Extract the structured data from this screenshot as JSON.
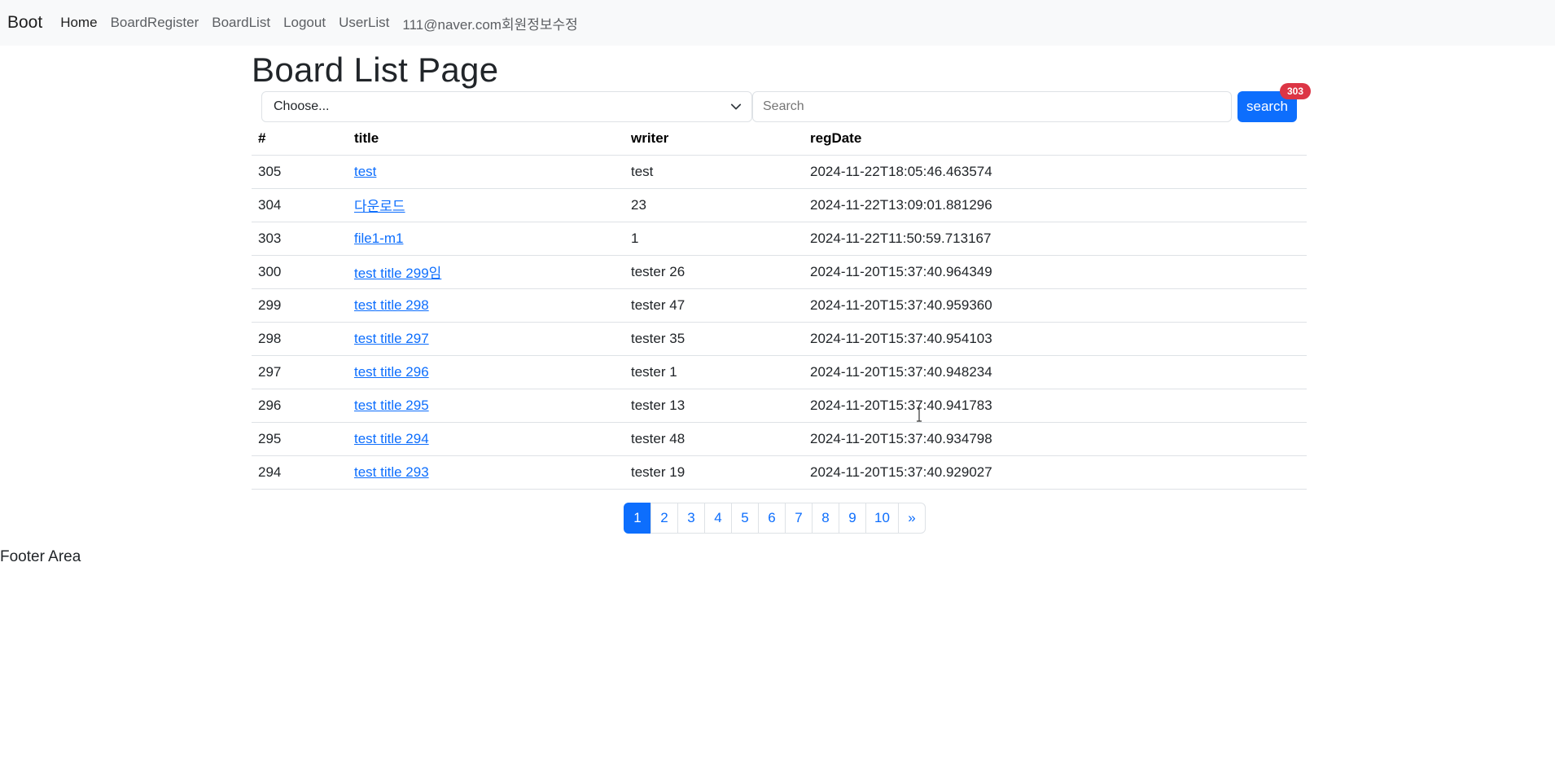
{
  "navbar": {
    "brand": "Boot",
    "items": [
      {
        "label": "Home",
        "active": true
      },
      {
        "label": "BoardRegister",
        "active": false
      },
      {
        "label": "BoardList",
        "active": false
      },
      {
        "label": "Logout",
        "active": false
      },
      {
        "label": "UserList",
        "active": false
      },
      {
        "label": "111@naver.com회원정보수정",
        "active": false
      }
    ]
  },
  "page_title": "Board List Page",
  "search": {
    "select_value": "Choose...",
    "placeholder": "Search",
    "button_label": "search",
    "badge_count": "303"
  },
  "table": {
    "headers": [
      "#",
      "title",
      "writer",
      "regDate"
    ],
    "rows": [
      {
        "id": "305",
        "title": "test",
        "writer": "test",
        "regDate": "2024-11-22T18:05:46.463574"
      },
      {
        "id": "304",
        "title": "다운로드",
        "writer": "23",
        "regDate": "2024-11-22T13:09:01.881296"
      },
      {
        "id": "303",
        "title": "file1-m1",
        "writer": "1",
        "regDate": "2024-11-22T11:50:59.713167"
      },
      {
        "id": "300",
        "title": "test title 299임",
        "writer": "tester 26",
        "regDate": "2024-11-20T15:37:40.964349"
      },
      {
        "id": "299",
        "title": "test title 298",
        "writer": "tester 47",
        "regDate": "2024-11-20T15:37:40.959360"
      },
      {
        "id": "298",
        "title": "test title 297",
        "writer": "tester 35",
        "regDate": "2024-11-20T15:37:40.954103"
      },
      {
        "id": "297",
        "title": "test title 296",
        "writer": "tester 1",
        "regDate": "2024-11-20T15:37:40.948234"
      },
      {
        "id": "296",
        "title": "test title 295",
        "writer": "tester 13",
        "regDate": "2024-11-20T15:37:40.941783"
      },
      {
        "id": "295",
        "title": "test title 294",
        "writer": "tester 48",
        "regDate": "2024-11-20T15:37:40.934798"
      },
      {
        "id": "294",
        "title": "test title 293",
        "writer": "tester 19",
        "regDate": "2024-11-20T15:37:40.929027"
      }
    ]
  },
  "pagination": {
    "pages": [
      "1",
      "2",
      "3",
      "4",
      "5",
      "6",
      "7",
      "8",
      "9",
      "10"
    ],
    "active": "1",
    "next_label": "»"
  },
  "footer": {
    "text": "Footer Area"
  },
  "colors": {
    "primary": "#0d6efd",
    "badge": "#dc3545",
    "navbar_bg": "#f8f9fa",
    "border": "#dee2e6"
  },
  "icons": {
    "select_arrow": "chevron-down-icon",
    "cursor": "text-cursor-icon"
  }
}
